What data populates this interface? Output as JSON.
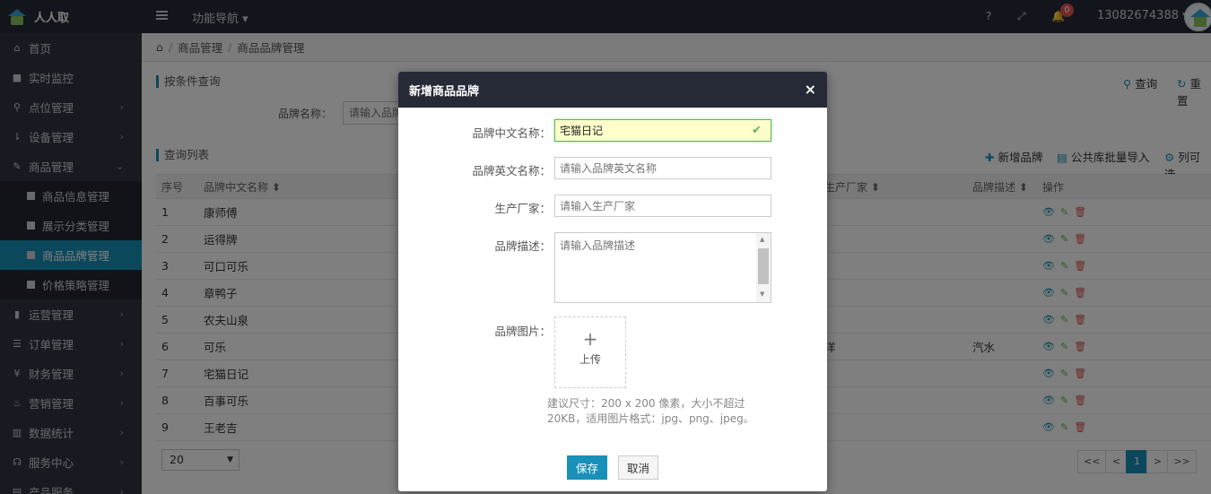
{
  "app": {
    "title": "人人取"
  },
  "topbar": {
    "nav_guide": "功能导航 ▾",
    "help": "?",
    "expand": "⤢",
    "bell": "🔔",
    "notifications": "0",
    "user": "13082674388 ▾"
  },
  "sidebar": {
    "items": [
      {
        "icon": "⌂",
        "label": "首页",
        "chev": ""
      },
      {
        "icon": "■",
        "label": "实时监控",
        "chev": ""
      },
      {
        "icon": "⚲",
        "label": "点位管理",
        "chev": "›"
      },
      {
        "icon": "⇂",
        "label": "设备管理",
        "chev": "›"
      },
      {
        "icon": "✎",
        "label": "商品管理",
        "chev": "⌄"
      }
    ],
    "sub_items": [
      {
        "label": "商品信息管理"
      },
      {
        "label": "展示分类管理"
      },
      {
        "label": "商品品牌管理"
      },
      {
        "label": "价格策略管理"
      }
    ],
    "items_after": [
      {
        "icon": "▮",
        "label": "运营管理",
        "chev": "›"
      },
      {
        "icon": "☰",
        "label": "订单管理",
        "chev": "›"
      },
      {
        "icon": "¥",
        "label": "财务管理",
        "chev": "›"
      },
      {
        "icon": "♨",
        "label": "营销管理",
        "chev": "›"
      },
      {
        "icon": "▥",
        "label": "数据统计",
        "chev": "›"
      },
      {
        "icon": "☊",
        "label": "服务中心",
        "chev": "›"
      },
      {
        "icon": "▤",
        "label": "产品服务",
        "chev": "›"
      }
    ]
  },
  "breadcrumb": {
    "home": "⌂",
    "sep1": "/",
    "level1": "商品管理",
    "sep2": "/",
    "level2": "商品品牌管理"
  },
  "filter": {
    "title": "按条件查询",
    "label": "品牌名称：",
    "placeholder": "请输入品牌名称",
    "query": "查询",
    "reset": "重置"
  },
  "list": {
    "title": "查询列表",
    "add": "新增品牌",
    "import": "公共库批量导入",
    "columns": "列可选"
  },
  "table": {
    "headers": {
      "no": "序号",
      "name": "品牌中文名称 ⬍",
      "maker": "生产厂家 ⬍",
      "desc": "品牌描述 ⬍",
      "action": "操作"
    },
    "rows": [
      {
        "no": "1",
        "name": "康师傅",
        "maker": "",
        "desc": ""
      },
      {
        "no": "2",
        "name": "运得牌",
        "maker": "",
        "desc": ""
      },
      {
        "no": "3",
        "name": "可口可乐",
        "maker": "",
        "desc": ""
      },
      {
        "no": "4",
        "name": "章鸭子",
        "maker": "",
        "desc": ""
      },
      {
        "no": "5",
        "name": "农夫山泉",
        "maker": "",
        "desc": ""
      },
      {
        "no": "6",
        "name": "可乐",
        "maker": "洋",
        "desc": "汽水"
      },
      {
        "no": "7",
        "name": "宅猫日记",
        "maker": "",
        "desc": ""
      },
      {
        "no": "8",
        "name": "百事可乐",
        "maker": "",
        "desc": ""
      },
      {
        "no": "9",
        "name": "王老吉",
        "maker": "",
        "desc": ""
      }
    ]
  },
  "pagination": {
    "page_size": "20",
    "first": "<<",
    "prev": "<",
    "current": "1",
    "next": ">",
    "last": ">>"
  },
  "modal": {
    "title": "新增商品品牌",
    "close": "×",
    "cn_name_label": "品牌中文名称：",
    "cn_name_value": "宅猫日记",
    "en_name_label": "品牌英文名称：",
    "en_name_placeholder": "请输入品牌英文名称",
    "maker_label": "生产厂家：",
    "maker_placeholder": "请输入生产厂家",
    "desc_label": "品牌描述：",
    "desc_placeholder": "请输入品牌描述",
    "image_label": "品牌图片：",
    "upload_plus": "+",
    "upload_text": "上传",
    "hint": "建议尺寸：200 x 200 像素，大小不超过20KB，适用图片格式：jpg、png、jpeg。",
    "save": "保存",
    "cancel": "取消"
  },
  "colors": {
    "accent": "#1990b8",
    "topbar": "#252a36",
    "sidebar": "#2f3440",
    "success": "#5cb85c",
    "danger": "#d9534f"
  }
}
